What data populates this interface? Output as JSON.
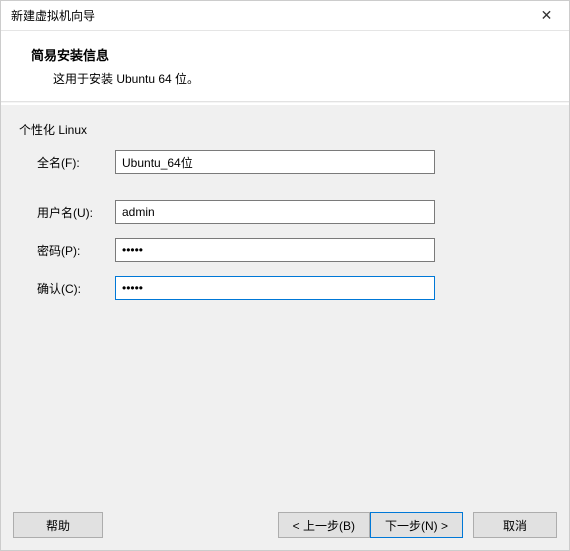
{
  "window": {
    "title": "新建虚拟机向导"
  },
  "header": {
    "heading": "简易安装信息",
    "subheading": "这用于安装 Ubuntu 64 位。"
  },
  "group": {
    "label": "个性化 Linux"
  },
  "form": {
    "fullname_label": "全名(F):",
    "fullname_value": "Ubuntu_64位",
    "username_label": "用户名(U):",
    "username_value": "admin",
    "password_label": "密码(P):",
    "password_value": "•••••",
    "confirm_label": "确认(C):",
    "confirm_value": "•••••"
  },
  "buttons": {
    "help": "帮助",
    "back": "< 上一步(B)",
    "next": "下一步(N) >",
    "cancel": "取消"
  }
}
